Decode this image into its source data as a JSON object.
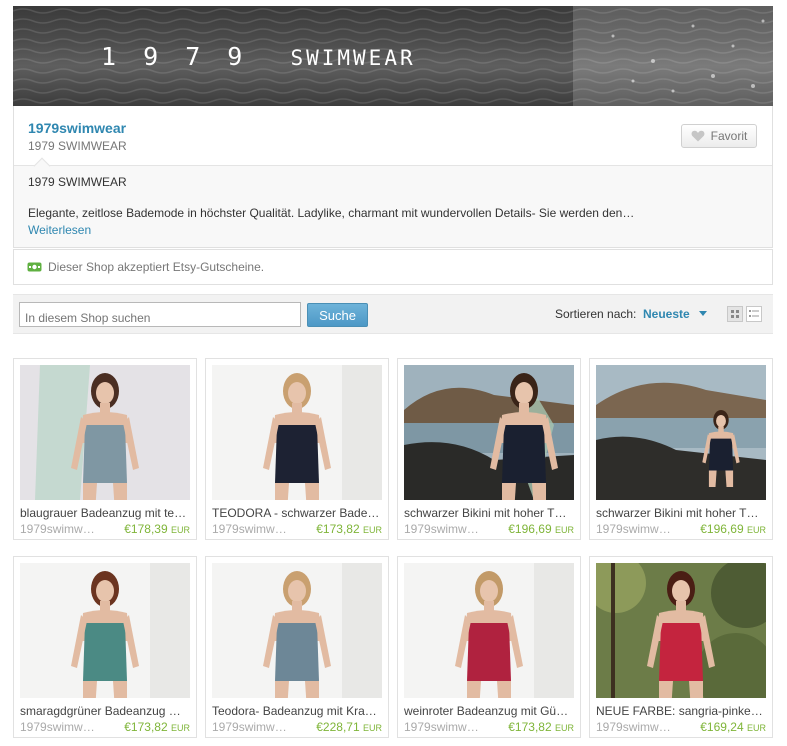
{
  "banner": {
    "title": "1 9 7 9",
    "title_word": "SWIMWEAR"
  },
  "shop": {
    "name": "1979swimwear",
    "subtitle": "1979 SWIMWEAR",
    "favorite_label": "Favorit",
    "about_title": "1979 SWIMWEAR",
    "about_text": "Elegante, zeitlose Bademode in höchster Qualität. Ladylike, charmant mit wundervollen Details- Sie werden den…",
    "read_more": "Weiterlesen"
  },
  "coupon": {
    "text": "Dieser Shop akzeptiert Etsy-Gutscheine.",
    "icon": "coupon-icon"
  },
  "search": {
    "placeholder": "In diesem Shop suchen",
    "button": "Suche"
  },
  "sort": {
    "label": "Sortieren nach:",
    "value": "Neueste"
  },
  "colors": {
    "accent": "#2f87b0",
    "price": "#7fb539"
  },
  "listings": [
    {
      "title": "blaugrauer Badeanzug mit te…",
      "shop": "1979swimw…",
      "price": "€178,39",
      "currency": "EUR",
      "scene": "studio-light",
      "suit": "#7f97a3",
      "hair": "#4a2e22"
    },
    {
      "title": "TEODORA - schwarzer Bade…",
      "shop": "1979swimw…",
      "price": "€173,82",
      "currency": "EUR",
      "scene": "studio-white",
      "suit": "#1d2233",
      "hair": "#c9a070"
    },
    {
      "title": "schwarzer Bikini mit hoher T…",
      "shop": "1979swimw…",
      "price": "€196,69",
      "currency": "EUR",
      "scene": "coast",
      "suit": "#1a2030",
      "hair": "#3a2418"
    },
    {
      "title": "schwarzer Bikini mit hoher T…",
      "shop": "1979swimw…",
      "price": "€196,69",
      "currency": "EUR",
      "scene": "coast-far",
      "suit": "#1a2030",
      "hair": "#3a2418"
    },
    {
      "title": "smaragdgrüner Badeanzug …",
      "shop": "1979swimw…",
      "price": "€173,82",
      "currency": "EUR",
      "scene": "studio-white",
      "suit": "#4b8a84",
      "hair": "#6b3420"
    },
    {
      "title": "Teodora- Badeanzug mit Kra…",
      "shop": "1979swimw…",
      "price": "€228,71",
      "currency": "EUR",
      "scene": "studio-white",
      "suit": "#6d8797",
      "hair": "#c9a070"
    },
    {
      "title": "weinroter Badeanzug mit Gü…",
      "shop": "1979swimw…",
      "price": "€173,82",
      "currency": "EUR",
      "scene": "studio-white",
      "suit": "#b0223f",
      "hair": "#c29a68"
    },
    {
      "title": "NEUE FARBE: sangria-pinke…",
      "shop": "1979swimw…",
      "price": "€169,24",
      "currency": "EUR",
      "scene": "forest",
      "suit": "#c4243e",
      "hair": "#4a1e14"
    }
  ]
}
